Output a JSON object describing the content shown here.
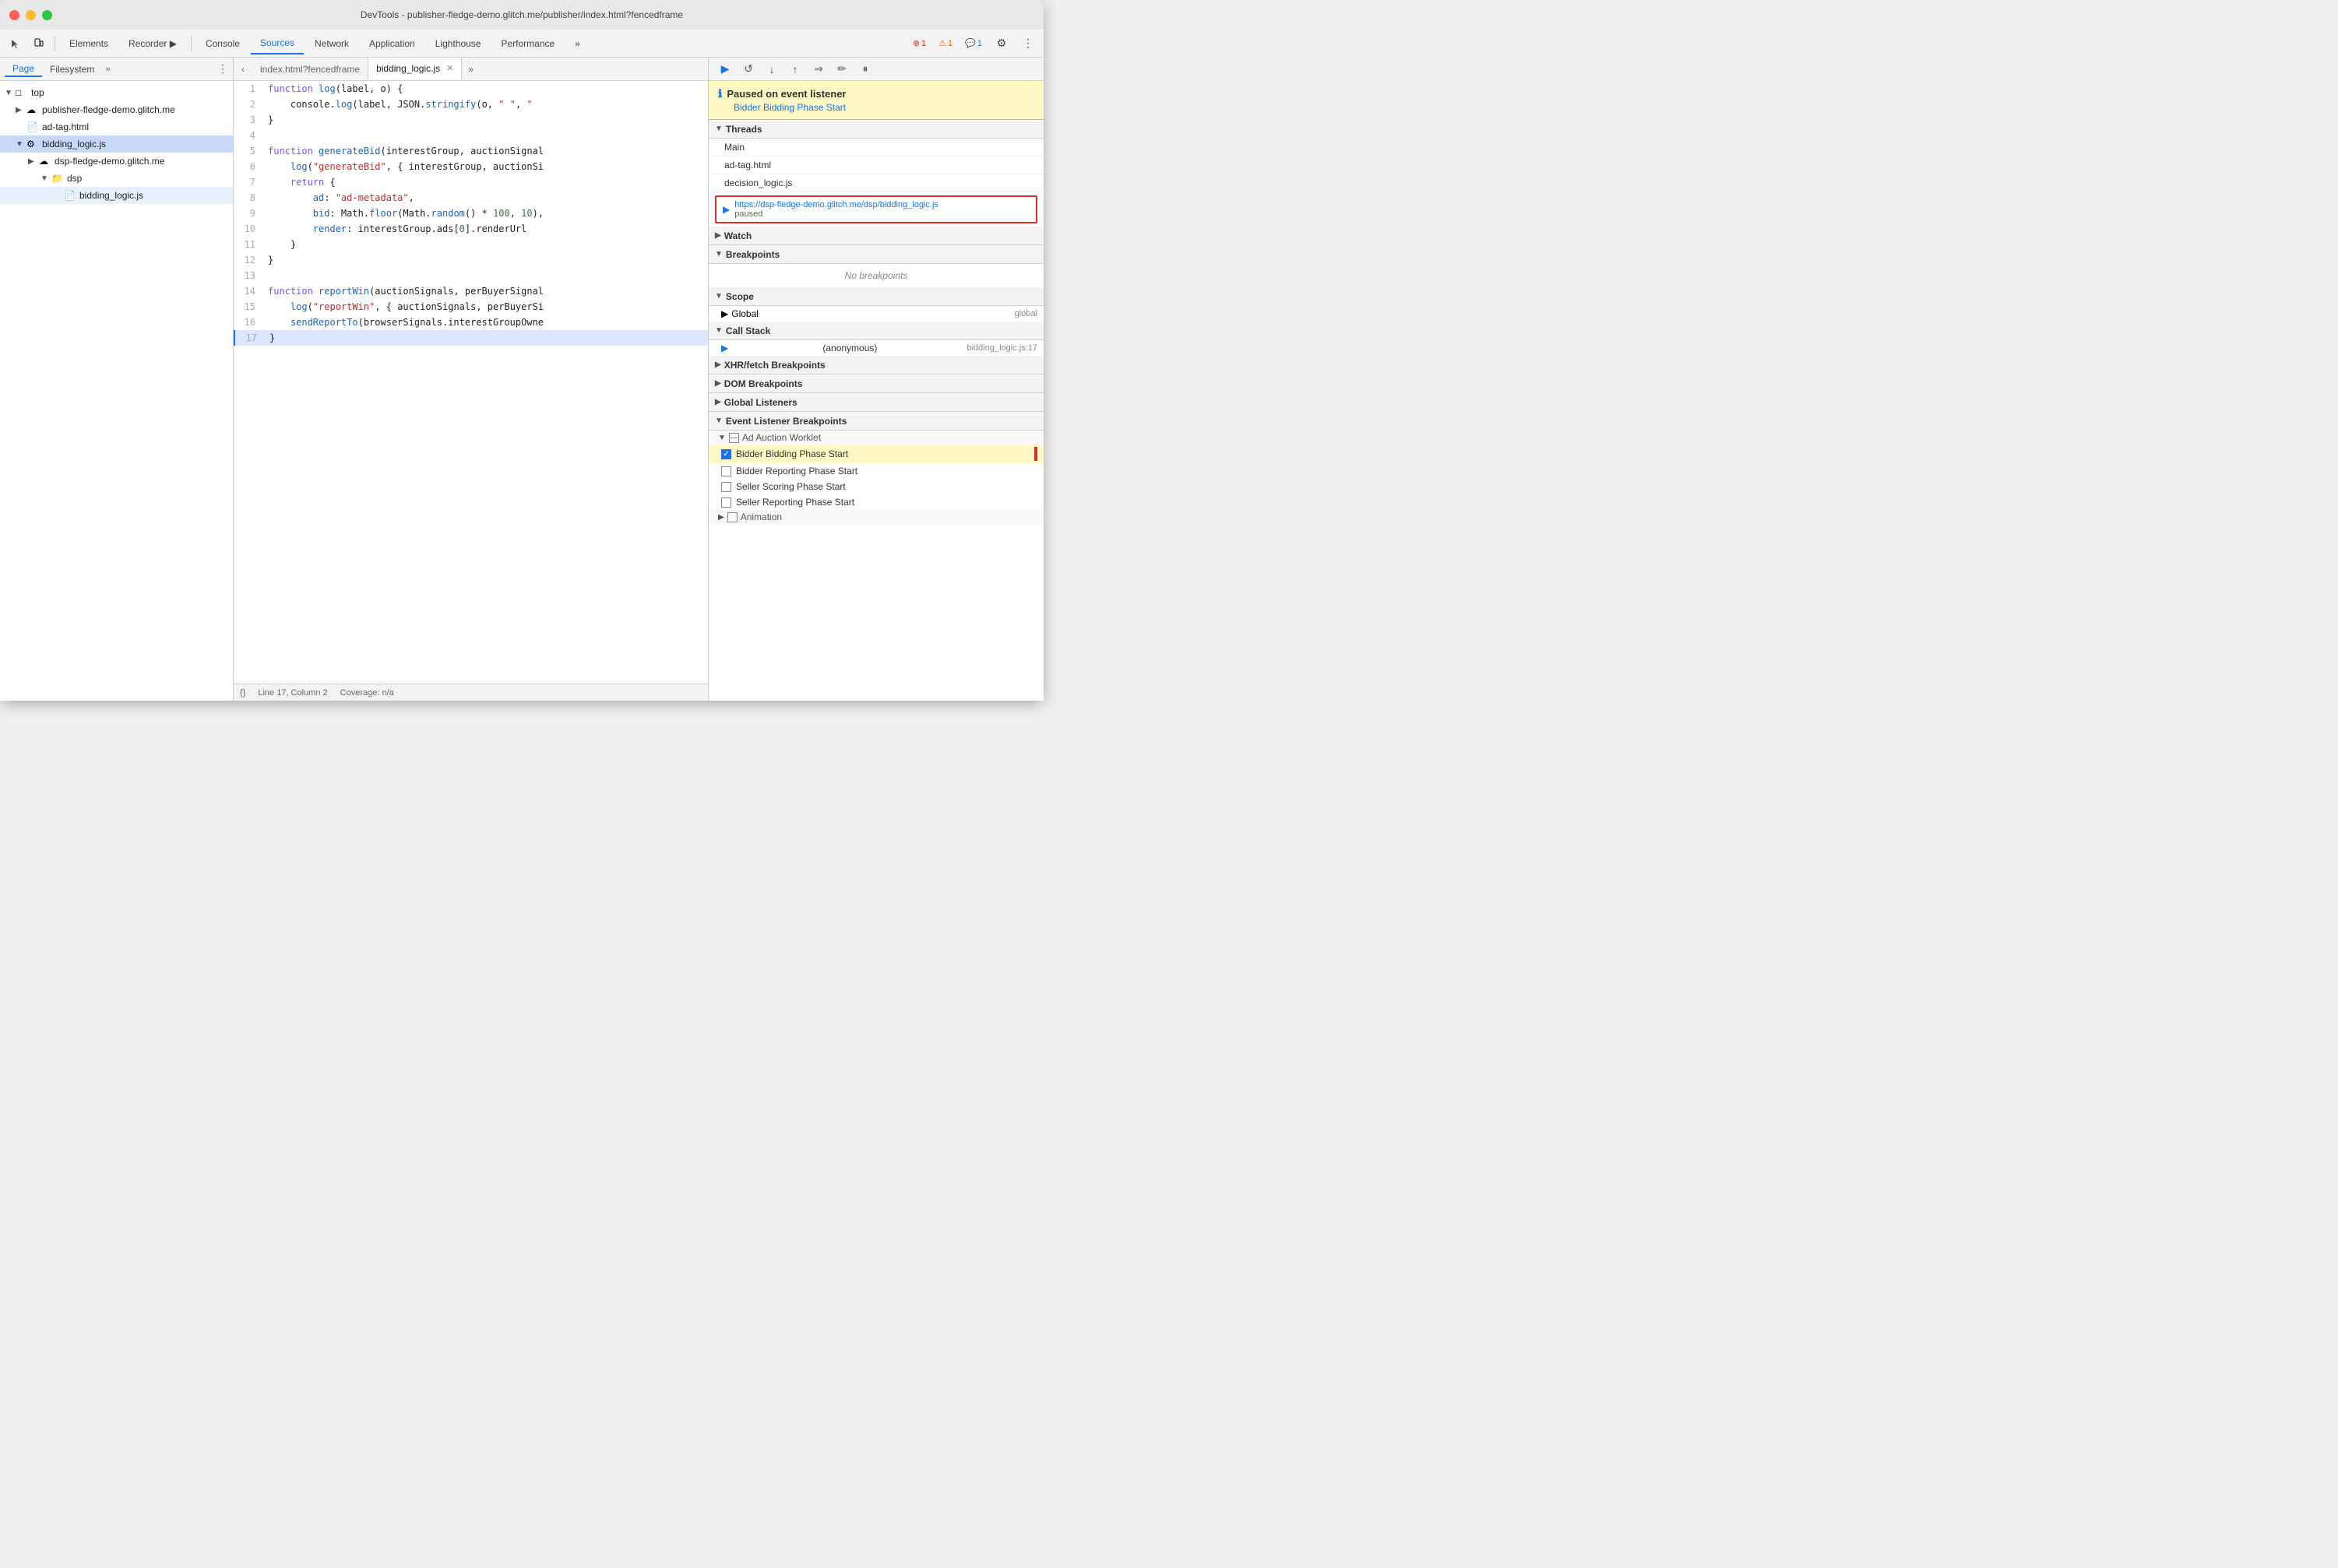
{
  "window": {
    "title": "DevTools - publisher-fledge-demo.glitch.me/publisher/index.html?fencedframe"
  },
  "toolbar": {
    "tabs": [
      {
        "label": "Elements",
        "active": false
      },
      {
        "label": "Recorder ▶",
        "active": false
      },
      {
        "label": "Console",
        "active": false
      },
      {
        "label": "Sources",
        "active": true
      },
      {
        "label": "Network",
        "active": false
      },
      {
        "label": "Application",
        "active": false
      },
      {
        "label": "Lighthouse",
        "active": false
      },
      {
        "label": "Performance",
        "active": false
      }
    ],
    "more_label": "»",
    "error_count": "1",
    "warn_count": "1",
    "info_count": "1"
  },
  "sidebar": {
    "tabs": [
      {
        "label": "Page",
        "active": true
      },
      {
        "label": "Filesystem",
        "active": false
      }
    ],
    "more_label": "»",
    "tree": [
      {
        "indent": 0,
        "arrow": "▼",
        "icon": "📄",
        "label": "top"
      },
      {
        "indent": 1,
        "arrow": "▶",
        "icon": "☁",
        "label": "publisher-fledge-demo.glitch.me"
      },
      {
        "indent": 1,
        "arrow": "",
        "icon": "📄",
        "label": "ad-tag.html"
      },
      {
        "indent": 1,
        "arrow": "▼",
        "icon": "⚙",
        "label": "bidding_logic.js",
        "active": true
      },
      {
        "indent": 2,
        "arrow": "▶",
        "icon": "☁",
        "label": "dsp-fledge-demo.glitch.me"
      },
      {
        "indent": 3,
        "arrow": "▼",
        "icon": "📁",
        "label": "dsp"
      },
      {
        "indent": 4,
        "arrow": "",
        "icon": "📄",
        "label": "bidding_logic.js",
        "highlight": true
      }
    ]
  },
  "editor": {
    "tabs": [
      {
        "label": "index.html?fencedframe",
        "active": false,
        "closeable": false
      },
      {
        "label": "bidding_logic.js",
        "active": true,
        "closeable": true
      }
    ],
    "lines": [
      {
        "num": 1,
        "content": "function log(label, o) {"
      },
      {
        "num": 2,
        "content": "    console.log(label, JSON.stringify(o, \" \", \""
      },
      {
        "num": 3,
        "content": "}"
      },
      {
        "num": 4,
        "content": ""
      },
      {
        "num": 5,
        "content": "function generateBid(interestGroup, auctionSignal"
      },
      {
        "num": 6,
        "content": "    log(\"generateBid\", { interestGroup, auctionSi"
      },
      {
        "num": 7,
        "content": "    return {"
      },
      {
        "num": 8,
        "content": "        ad: \"ad-metadata\","
      },
      {
        "num": 9,
        "content": "        bid: Math.floor(Math.random() * 100, 10),"
      },
      {
        "num": 10,
        "content": "        render: interestGroup.ads[0].renderUrl"
      },
      {
        "num": 11,
        "content": "    }"
      },
      {
        "num": 12,
        "content": "}"
      },
      {
        "num": 13,
        "content": ""
      },
      {
        "num": 14,
        "content": "function reportWin(auctionSignals, perBuyerSignal"
      },
      {
        "num": 15,
        "content": "    log(\"reportWin\", { auctionSignals, perBuyerSi"
      },
      {
        "num": 16,
        "content": "    sendReportTo(browserSignals.interestGroupOwne"
      },
      {
        "num": 17,
        "content": "}",
        "current": true
      }
    ],
    "status": {
      "format_icon": "{}",
      "position": "Line 17, Column 2",
      "coverage": "Coverage: n/a"
    }
  },
  "debugger": {
    "pause_notice": {
      "title": "Paused on event listener",
      "subtitle": "Bidder Bidding Phase Start"
    },
    "sections": {
      "threads": {
        "label": "Threads",
        "items": [
          {
            "label": "Main"
          },
          {
            "label": "ad-tag.html"
          },
          {
            "label": "decision_logic.js"
          },
          {
            "label": "https://dsp-fledge-demo.glitch.me/dsp/bidding_logic.js",
            "paused": "paused",
            "active": true
          }
        ]
      },
      "watch": {
        "label": "Watch"
      },
      "breakpoints": {
        "label": "Breakpoints",
        "empty": "No breakpoints"
      },
      "scope": {
        "label": "Scope",
        "items": [
          {
            "label": "▶ Global",
            "value": "global"
          }
        ]
      },
      "call_stack": {
        "label": "Call Stack",
        "items": [
          {
            "label": "(anonymous)",
            "location": "bidding_logic.js:17"
          }
        ]
      },
      "xhr_breakpoints": {
        "label": "XHR/fetch Breakpoints"
      },
      "dom_breakpoints": {
        "label": "DOM Breakpoints"
      },
      "global_listeners": {
        "label": "Global Listeners"
      },
      "event_listener_breakpoints": {
        "label": "Event Listener Breakpoints",
        "subsections": [
          {
            "label": "Ad Auction Worklet",
            "items": [
              {
                "label": "Bidder Bidding Phase Start",
                "checked": true,
                "highlighted": true
              },
              {
                "label": "Bidder Reporting Phase Start",
                "checked": false
              },
              {
                "label": "Seller Scoring Phase Start",
                "checked": false
              },
              {
                "label": "Seller Reporting Phase Start",
                "checked": false
              }
            ]
          },
          {
            "label": "Animation"
          }
        ]
      }
    }
  }
}
